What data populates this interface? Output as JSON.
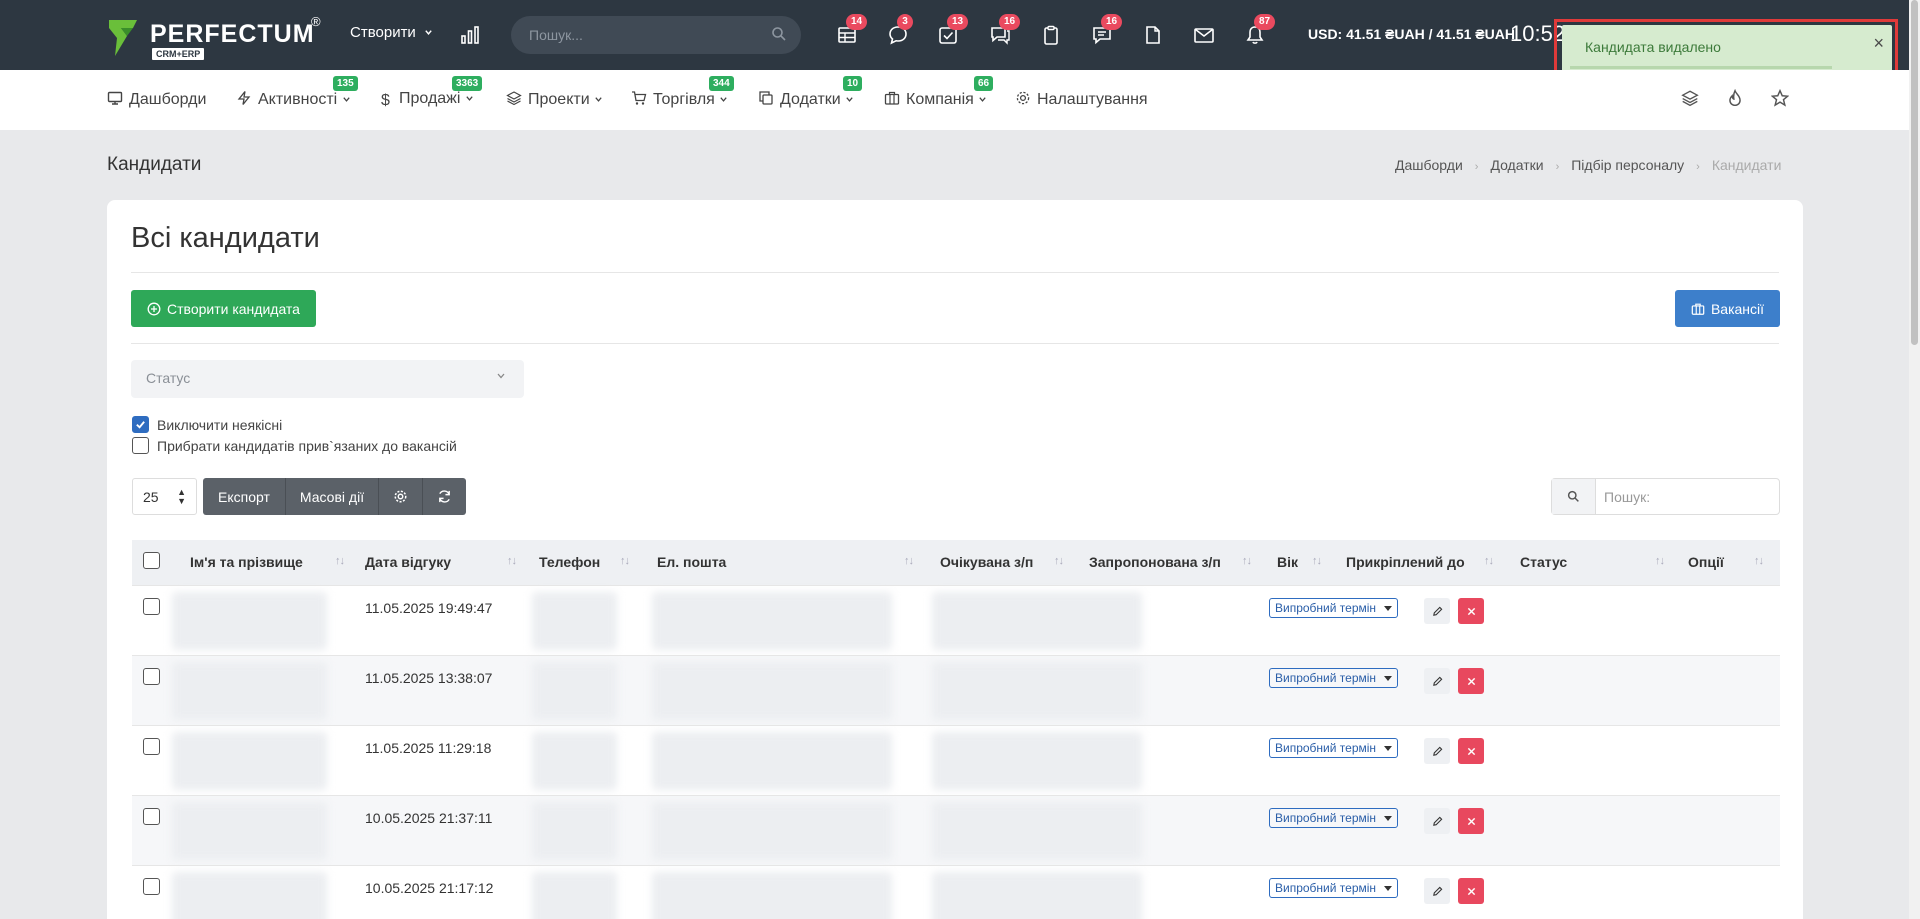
{
  "brand": {
    "name": "PERFECTUM",
    "reg": "®",
    "sub": "CRM+ERP"
  },
  "topbar": {
    "create_label": "Створити",
    "search_placeholder": "Пошук...",
    "icons": [
      {
        "name": "table-icon",
        "badge": "14"
      },
      {
        "name": "chat-icon",
        "badge": "3"
      },
      {
        "name": "tasks-icon",
        "badge": "13"
      },
      {
        "name": "comments-icon",
        "badge": "16"
      },
      {
        "name": "clipboard-icon",
        "badge": ""
      },
      {
        "name": "notes-icon",
        "badge": "16"
      },
      {
        "name": "file-icon",
        "badge": ""
      },
      {
        "name": "mail-icon",
        "badge": ""
      },
      {
        "name": "bell-icon",
        "badge": "87"
      }
    ],
    "currency": "USD: 41.51 ₴UAH / 41.51 ₴UAH",
    "clock": "10:52"
  },
  "toast": {
    "message": "Кандидата видалено",
    "close": "×"
  },
  "nav": {
    "items": [
      {
        "label": "Дашборди",
        "badge": ""
      },
      {
        "label": "Активності",
        "badge": "135"
      },
      {
        "label": "Продажі",
        "badge": "3363"
      },
      {
        "label": "Проекти",
        "badge": ""
      },
      {
        "label": "Торгівля",
        "badge": "344"
      },
      {
        "label": "Додатки",
        "badge": "10"
      },
      {
        "label": "Компанія",
        "badge": "66"
      },
      {
        "label": "Налаштування",
        "badge": ""
      }
    ]
  },
  "page": {
    "title": "Кандидати",
    "breadcrumb": [
      "Дашборди",
      "Додатки",
      "Підбір персоналу",
      "Кандидати"
    ]
  },
  "card": {
    "title": "Всі кандидати",
    "create_button": "Створити кандидата",
    "vacancies_button": "Вакансії",
    "status_placeholder": "Статус",
    "checkbox_exclude": "Виключити неякісні",
    "checkbox_exclude_checked": true,
    "checkbox_remove_linked": "Прибрати кандидатів прив`язаних до вакансій",
    "checkbox_remove_linked_checked": false,
    "per_page": "25",
    "export_label": "Експорт",
    "bulk_label": "Масові дії",
    "search_placeholder": "Пошук:"
  },
  "table": {
    "columns": [
      "Ім'я та прізвище",
      "Дата відгуку",
      "Телефон",
      "Ел. пошта",
      "Очікувана з/п",
      "Запропонована з/п",
      "Вік",
      "Прикріплений до",
      "Статус",
      "Опції"
    ],
    "rows": [
      {
        "date": "11.05.2025 19:49:47",
        "status": "Випробний термін"
      },
      {
        "date": "11.05.2025 13:38:07",
        "status": "Випробний термін"
      },
      {
        "date": "11.05.2025 11:29:18",
        "status": "Випробний термін"
      },
      {
        "date": "10.05.2025 21:37:11",
        "status": "Випробний термін"
      },
      {
        "date": "10.05.2025 21:17:12",
        "status": "Випробний термін"
      }
    ]
  },
  "colors": {
    "topbar": "#2d3741",
    "green": "#2ea858",
    "blue": "#3d7fcb",
    "badge_red": "#ea4a5f",
    "badge_green": "#2eae5f",
    "delete_red": "#e8485e"
  }
}
